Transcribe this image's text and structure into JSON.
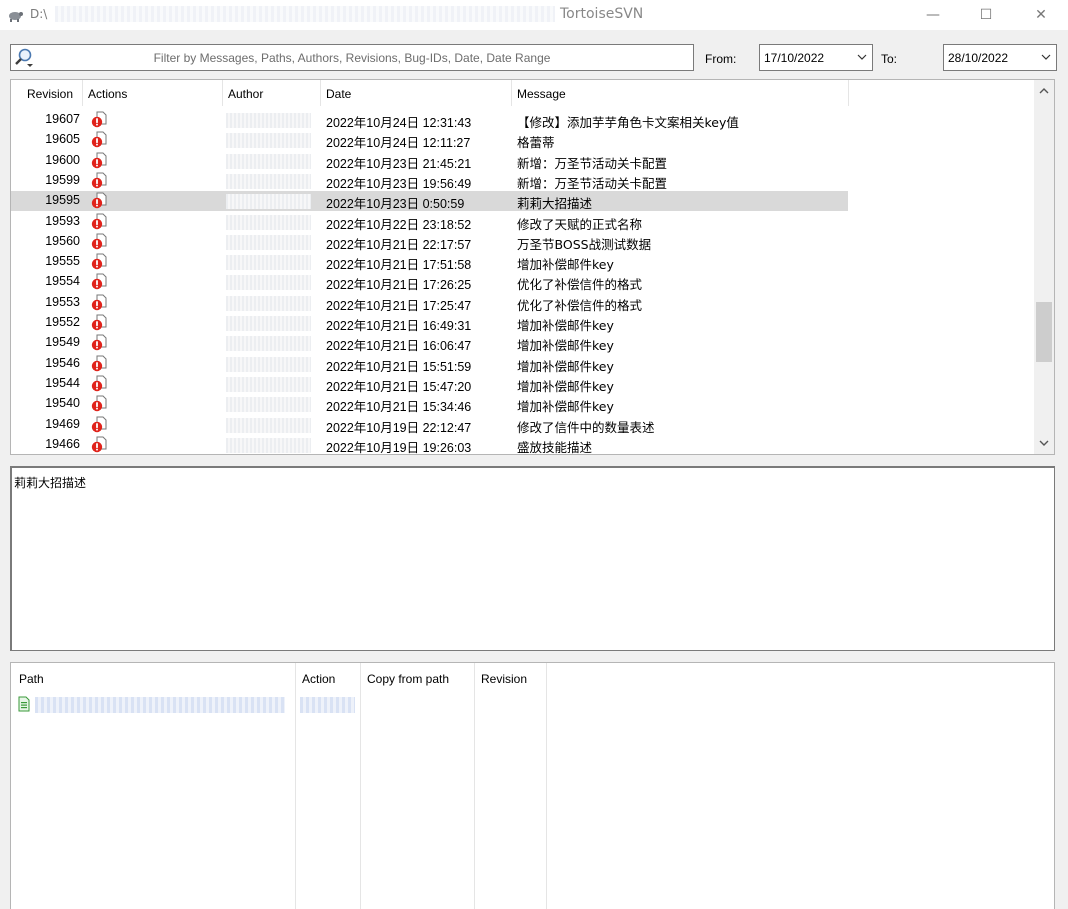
{
  "window": {
    "path": "D:\\",
    "title": "TortoiseSVN",
    "minimize": "—",
    "maximize": "☐",
    "close": "✕"
  },
  "filter": {
    "placeholder": "Filter by Messages, Paths, Authors, Revisions, Bug-IDs, Date, Date Range",
    "from_label": "From:",
    "from_value": "17/10/2022",
    "to_label": "To:",
    "to_value": "28/10/2022"
  },
  "log": {
    "columns": [
      "Revision",
      "Actions",
      "Author",
      "Date",
      "Message"
    ],
    "selected_revision": "19595",
    "rows": [
      {
        "revision": "19607",
        "date": "2022年10月24日 12:31:43",
        "message": "【修改】添加芋芋角色卡文案相关key值"
      },
      {
        "revision": "19605",
        "date": "2022年10月24日 12:11:27",
        "message": "格蕾蒂"
      },
      {
        "revision": "19600",
        "date": "2022年10月23日 21:45:21",
        "message": "新增：万圣节活动关卡配置"
      },
      {
        "revision": "19599",
        "date": "2022年10月23日 19:56:49",
        "message": "新增：万圣节活动关卡配置"
      },
      {
        "revision": "19595",
        "date": "2022年10月23日 0:50:59",
        "message": "莉莉大招描述"
      },
      {
        "revision": "19593",
        "date": "2022年10月22日 23:18:52",
        "message": "修改了天赋的正式名称"
      },
      {
        "revision": "19560",
        "date": "2022年10月21日 22:17:57",
        "message": "万圣节BOSS战测试数据"
      },
      {
        "revision": "19555",
        "date": "2022年10月21日 17:51:58",
        "message": "增加补偿邮件key"
      },
      {
        "revision": "19554",
        "date": "2022年10月21日 17:26:25",
        "message": "优化了补偿信件的格式"
      },
      {
        "revision": "19553",
        "date": "2022年10月21日 17:25:47",
        "message": "优化了补偿信件的格式"
      },
      {
        "revision": "19552",
        "date": "2022年10月21日 16:49:31",
        "message": "增加补偿邮件key"
      },
      {
        "revision": "19549",
        "date": "2022年10月21日 16:06:47",
        "message": "增加补偿邮件key"
      },
      {
        "revision": "19546",
        "date": "2022年10月21日 15:51:59",
        "message": "增加补偿邮件key"
      },
      {
        "revision": "19544",
        "date": "2022年10月21日 15:47:20",
        "message": "增加补偿邮件key"
      },
      {
        "revision": "19540",
        "date": "2022年10月21日 15:34:46",
        "message": "增加补偿邮件key"
      },
      {
        "revision": "19469",
        "date": "2022年10月19日 22:12:47",
        "message": "修改了信件中的数量表述"
      },
      {
        "revision": "19466",
        "date": "2022年10月19日 19:26:03",
        "message": "盛放技能描述"
      }
    ]
  },
  "message_pane": {
    "text": "莉莉大招描述"
  },
  "paths": {
    "columns": [
      "Path",
      "Action",
      "Copy from path",
      "Revision"
    ]
  },
  "colors": {
    "selection": "#d9d9d9",
    "action_icon_red": "#e0231b",
    "scroll_thumb": "#cdcdcd"
  },
  "icons": [
    "tortoise-icon",
    "search-icon",
    "chevron-down-icon",
    "modified-icon",
    "file-icon",
    "arrow-up-icon",
    "arrow-down-icon"
  ]
}
